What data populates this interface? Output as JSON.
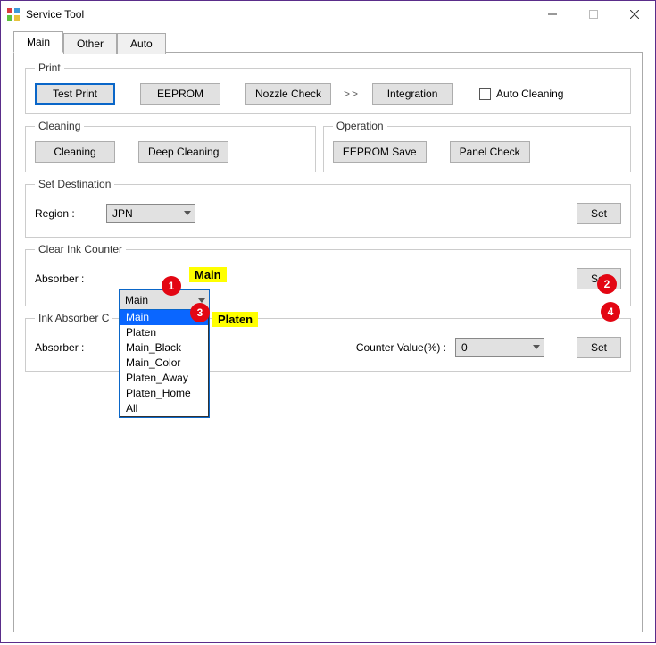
{
  "window": {
    "title": "Service Tool"
  },
  "tabs": {
    "main": "Main",
    "other": "Other",
    "auto": "Auto"
  },
  "print": {
    "legend": "Print",
    "test_print": "Test Print",
    "eeprom": "EEPROM",
    "nozzle_check": "Nozzle Check",
    "arrows": ">>",
    "integration": "Integration",
    "auto_cleaning": "Auto Cleaning"
  },
  "cleaning": {
    "legend": "Cleaning",
    "cleaning": "Cleaning",
    "deep_cleaning": "Deep Cleaning"
  },
  "operation": {
    "legend": "Operation",
    "eeprom_save": "EEPROM Save",
    "panel_check": "Panel Check"
  },
  "destination": {
    "legend": "Set Destination",
    "region_label": "Region :",
    "region_value": "JPN",
    "set": "Set"
  },
  "clear_ink": {
    "legend": "Clear Ink Counter",
    "absorber_label": "Absorber :",
    "absorber_value": "Main",
    "options": [
      "Main",
      "Platen",
      "Main_Black",
      "Main_Color",
      "Platen_Away",
      "Platen_Home",
      "All"
    ],
    "set": "Set"
  },
  "ink_abs_counter": {
    "legend_partial": "Ink Absorber C",
    "absorber_label": "Absorber :",
    "counter_label": "Counter Value(%) :",
    "counter_value": "0",
    "set": "Set"
  },
  "annotations": {
    "hl_main": "Main",
    "hl_platen": "Platen",
    "n1": "1",
    "n2": "2",
    "n3": "3",
    "n4": "4"
  }
}
